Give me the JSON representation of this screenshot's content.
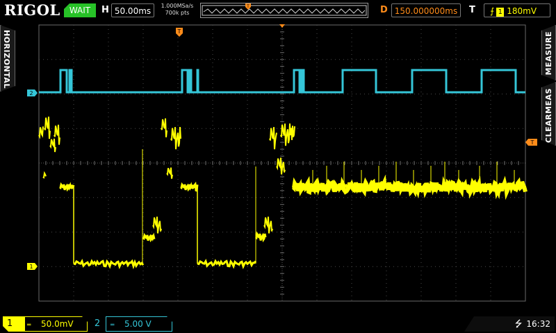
{
  "topbar": {
    "logo": "RIGOL",
    "run_status": "WAIT",
    "horizontal_label": "H",
    "time_per_div": "50.00ms",
    "sample_rate": "1.000MSa/s",
    "memory_depth": "700k pts",
    "delay_label": "D",
    "delay_value": "150.000000ms",
    "trigger_label": "T",
    "trigger_source": "1",
    "trigger_level": "180mV"
  },
  "side_tabs": {
    "left": "HORIZONTAL",
    "right_top": "MEASURE",
    "right_bottom": "CLEARMEAS"
  },
  "markers": {
    "trigger_position": "T",
    "trigger_level": "T",
    "channel1": "1",
    "channel2": "2"
  },
  "bottombar": {
    "ch1_number": "1",
    "ch1_coupling": "DC",
    "ch1_scale": "50.0mV",
    "ch2_number": "2",
    "ch2_coupling": "DC",
    "ch2_scale": "5.00 V",
    "time": "16:32"
  },
  "colors": {
    "ch1": "#ffff00",
    "ch2": "#35c6d8",
    "trigger": "#ff8c1a",
    "status_wait": "#27c227"
  }
}
